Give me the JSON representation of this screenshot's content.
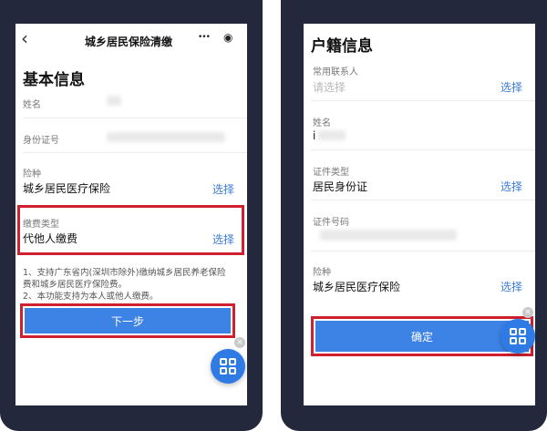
{
  "left_phone": {
    "nav": {
      "title": "城乡居民保险清缴",
      "back_icon": "‹",
      "more_icon": "•••",
      "target_icon": "◉"
    },
    "section_title": "基本信息",
    "fields": {
      "name_label": "姓名",
      "id_label": "身份证号",
      "insurance_type_label": "险种",
      "insurance_type_value": "城乡居民医疗保险",
      "insurance_type_action": "选择",
      "payment_type_label": "缴费类型",
      "payment_type_value": "代他人缴费",
      "payment_type_action": "选择"
    },
    "notice_lines": [
      "1、支持广东省内(深圳市除外)缴纳城乡居民养老保险",
      "费和城乡居民医疗保险费。",
      "2、本功能支持为本人或他人缴费。"
    ],
    "next_button": "下一步",
    "fab_close": "×"
  },
  "right_phone": {
    "section_title": "户籍信息",
    "fields": {
      "contact_label": "常用联系人",
      "contact_placeholder": "请选择",
      "contact_action": "选择",
      "name_label": "姓名",
      "name_partial": "i",
      "cert_type_label": "证件类型",
      "cert_type_value": "居民身份证",
      "cert_type_action": "选择",
      "cert_no_label": "证件号码",
      "insurance_type_label": "险种",
      "insurance_type_value": "城乡居民医疗保险",
      "insurance_type_action": "选择"
    },
    "confirm_button": "确定",
    "fab_close": "×"
  },
  "colors": {
    "frame": "#23283c",
    "accent": "#3d83e6",
    "highlight": "#d01f2e",
    "link": "#3a7bd5"
  }
}
